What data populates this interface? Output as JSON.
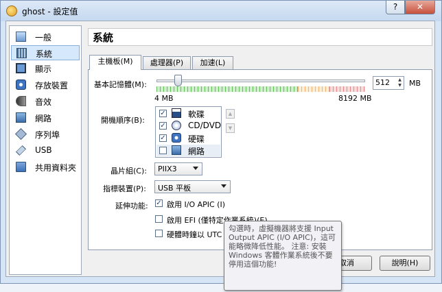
{
  "window": {
    "title": "ghost - 設定值",
    "help_label": "?",
    "close_label": "✕"
  },
  "sidebar": {
    "items": [
      {
        "label": "一般",
        "icon": "monitor-general-icon"
      },
      {
        "label": "系統",
        "icon": "system-chip-icon",
        "selected": true
      },
      {
        "label": "顯示",
        "icon": "display-icon"
      },
      {
        "label": "存放裝置",
        "icon": "storage-disk-icon"
      },
      {
        "label": "音效",
        "icon": "speaker-icon"
      },
      {
        "label": "網路",
        "icon": "network-icon"
      },
      {
        "label": "序列埠",
        "icon": "serial-port-icon"
      },
      {
        "label": "USB",
        "icon": "usb-icon"
      },
      {
        "label": "共用資料夾",
        "icon": "shared-folder-icon"
      }
    ]
  },
  "header": {
    "title": "系統"
  },
  "tabs": [
    {
      "label": "主機板(M)",
      "active": true
    },
    {
      "label": "處理器(P)",
      "active": false
    },
    {
      "label": "加速(L)",
      "active": false
    }
  ],
  "memory": {
    "label": "基本記憶體(M):",
    "value": "512",
    "unit": "MB",
    "min_label": "4 MB",
    "max_label": "8192 MB",
    "min_mb": 4,
    "max_mb": 8192,
    "current_mb": 512
  },
  "boot_order": {
    "label": "開機順序(B):",
    "items": [
      {
        "label": "軟碟",
        "checked": true,
        "icon": "floppy-icon"
      },
      {
        "label": "CD/DVD",
        "checked": true,
        "icon": "cd-dvd-icon"
      },
      {
        "label": "硬碟",
        "checked": true,
        "icon": "hard-disk-icon"
      },
      {
        "label": "網路",
        "checked": false,
        "icon": "network-icon"
      }
    ]
  },
  "chipset": {
    "label": "晶片組(C):",
    "value": "PIIX3"
  },
  "pointing": {
    "label": "指標裝置(P):",
    "value": "USB 平板"
  },
  "extended": {
    "label": "延伸功能:",
    "options": [
      {
        "label": "啟用 I/O APIC (I)",
        "checked": true
      },
      {
        "label": "啟用 EFI (僅特定作業系統)(E)",
        "checked": false
      },
      {
        "label": "硬體時鐘以 UTC",
        "checked": false
      }
    ]
  },
  "buttons": {
    "cancel": "取消",
    "help": "說明(H)"
  },
  "tooltip": {
    "text": "勾選時，虛擬機器將支援 Input Output APIC (I/O APIC)，這可能略微降低性能。 注意: 安裝 Windows 客體作業系統後不要停用這個功能!"
  },
  "colors": {
    "selection": "#d6e8fb",
    "slider_green": "#56b04a",
    "slider_orange": "#e8a060",
    "slider_red": "#e07070"
  }
}
